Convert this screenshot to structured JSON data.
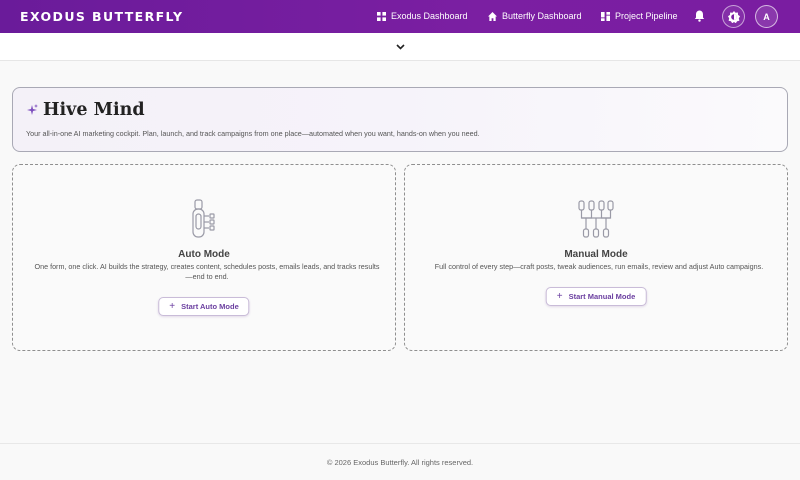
{
  "header": {
    "brand": "EXODUS BUTTERFLY",
    "nav": [
      {
        "label": "Exodus Dashboard",
        "icon": "grid-icon"
      },
      {
        "label": "Butterfly Dashboard",
        "icon": "home-icon"
      },
      {
        "label": "Project Pipeline",
        "icon": "dashboard-icon"
      }
    ],
    "avatar_initial": "A"
  },
  "hero": {
    "title": "Hive Mind",
    "subtitle": "Your all-in-one AI marketing cockpit. Plan, launch, and track campaigns from one place—automated when you want, hands-on when you need."
  },
  "modes": {
    "auto": {
      "title": "Auto Mode",
      "description": "One form, one click. AI builds the strategy, creates content, schedules posts, emails leads, and tracks results—end to end.",
      "button": "Start Auto Mode"
    },
    "manual": {
      "title": "Manual Mode",
      "description": "Full control of every step—craft posts, tweak audiences, run emails, review and adjust Auto campaigns.",
      "button": "Start Manual Mode"
    }
  },
  "footer": {
    "text": "© 2026 Exodus Butterfly. All rights reserved."
  },
  "colors": {
    "header": "#7b1fa2",
    "accent": "#6b3fa0"
  }
}
